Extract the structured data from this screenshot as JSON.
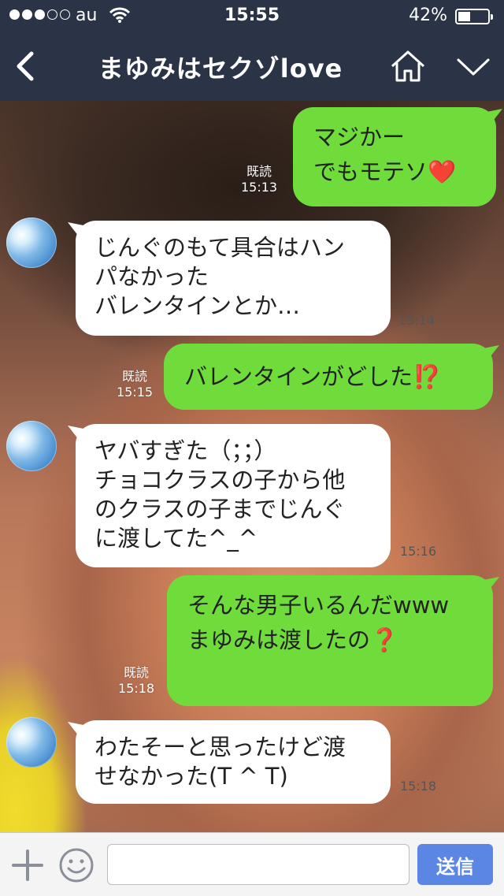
{
  "status": {
    "carrier": "au",
    "time": "15:55",
    "battery": "42%",
    "battery_level": 0.42
  },
  "header": {
    "title": "まゆみはセクゾlove"
  },
  "messages": [
    {
      "dir": "out",
      "text": "マジかー\nでもモテソ",
      "emoji": "❤️",
      "read": "既読",
      "time": "15:13"
    },
    {
      "dir": "in",
      "text": "じんぐのもて具合はハン\nパなかった\nバレンタインとか…",
      "time": "15:14"
    },
    {
      "dir": "out",
      "text": "バレンタインがどした",
      "emoji": "⁉️",
      "read": "既読",
      "time": "15:15"
    },
    {
      "dir": "in",
      "text": "ヤバすぎた（；；）\nチョコクラスの子から他\nのクラスの子までじんぐ\nに渡してた^_^",
      "time": "15:16"
    },
    {
      "dir": "out",
      "text": "そんな男子いるんだwww\nまゆみは渡したの",
      "emoji": "❓",
      "read": "既読",
      "time": "15:18"
    },
    {
      "dir": "in",
      "text": "わたそーと思ったけど渡\nせなかった(T ^ T)",
      "time": "15:18"
    }
  ],
  "input": {
    "placeholder": "",
    "send_label": "送信"
  },
  "icons": {
    "back": "chevron-left-icon",
    "home": "home-icon",
    "menu": "chevron-down-icon",
    "add": "plus-icon",
    "sticker": "smiley-icon"
  },
  "colors": {
    "nav_bg": "#2b3446",
    "out_bubble": "#6fdc3c",
    "in_bubble": "#ffffff",
    "send_button": "#5b86e3"
  }
}
